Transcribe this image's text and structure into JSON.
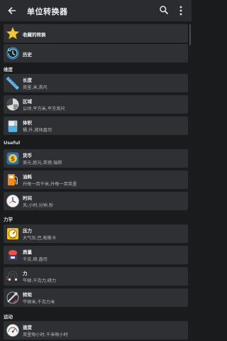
{
  "appbar": {
    "title": "单位转换器",
    "back_icon": "back-arrow-icon",
    "search_icon": "search-icon",
    "more_icon": "more-vert-icon"
  },
  "top_items": [
    {
      "name": "收藏的转换",
      "icon": "star-icon"
    },
    {
      "name": "历史",
      "icon": "history-icon"
    }
  ],
  "sections": [
    {
      "title": "维度",
      "items": [
        {
          "name": "长度",
          "sub": "英里,米,英尺",
          "icon": "ruler-icon"
        },
        {
          "name": "区域",
          "sub": "公顷,平方米,平方英尺",
          "icon": "area-icon"
        },
        {
          "name": "体积",
          "sub": "桶,升,液体盎司",
          "icon": "beaker-icon"
        }
      ]
    },
    {
      "title": "Useful",
      "items": [
        {
          "name": "货币",
          "sub": "美元,欧元,英镑,瑞郎",
          "icon": "currency-icon"
        },
        {
          "name": "油耗",
          "sub": "升每一百千米,升每一百英里",
          "icon": "fuel-pump-icon"
        },
        {
          "name": "时间",
          "sub": "天,小时,分钟,秒",
          "icon": "clock-icon"
        }
      ]
    },
    {
      "title": "力学",
      "items": [
        {
          "name": "压力",
          "sub": "大气压,巴,帕斯卡",
          "icon": "pressure-gauge-icon"
        },
        {
          "name": "质量",
          "sub": "千克,磅,盎司",
          "icon": "weight-icon"
        },
        {
          "name": "力",
          "sub": "牛顿,千克力,磅力",
          "icon": "magnet-icon"
        },
        {
          "name": "转矩",
          "sub": "牛顿米,千克力米",
          "icon": "torque-icon"
        }
      ]
    },
    {
      "title": "运动",
      "items": [
        {
          "name": "速度",
          "sub": "英里每小时,千米每小时",
          "icon": "speedometer-icon"
        }
      ]
    }
  ]
}
